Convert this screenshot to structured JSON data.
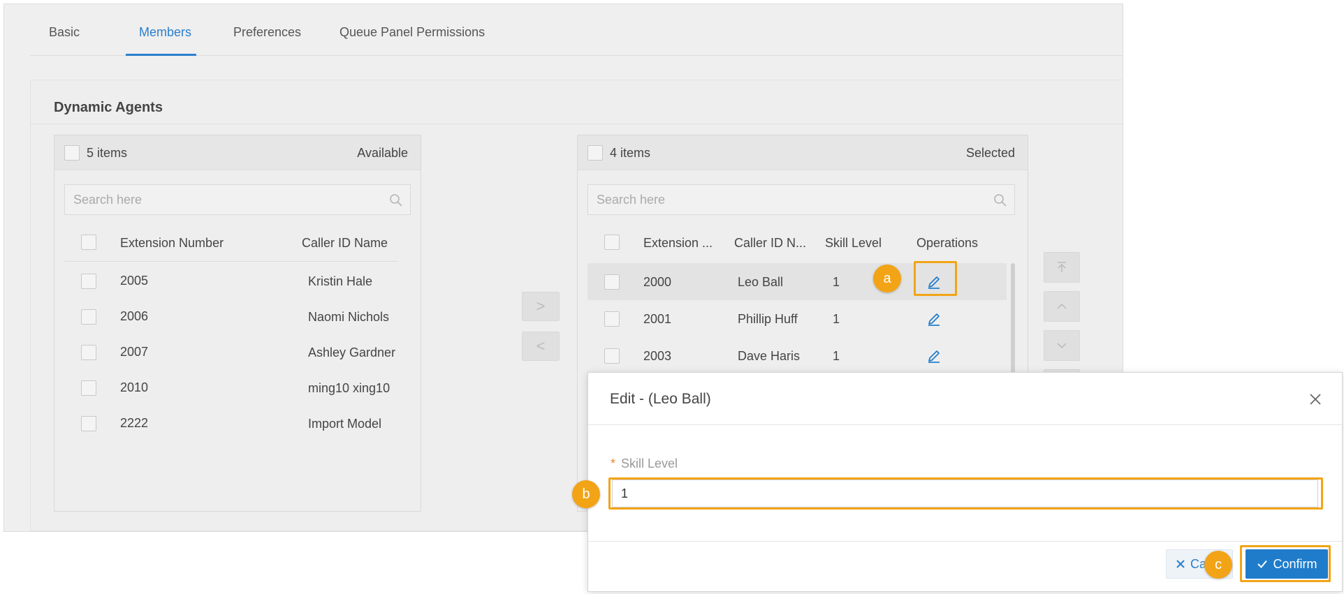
{
  "tabs": [
    {
      "label": "Basic",
      "active": false
    },
    {
      "label": "Members",
      "active": true
    },
    {
      "label": "Preferences",
      "active": false
    },
    {
      "label": "Queue Panel Permissions",
      "active": false
    }
  ],
  "section": {
    "title": "Dynamic Agents"
  },
  "available": {
    "count_label": "5 items",
    "label": "Available",
    "search_placeholder": "Search here",
    "columns": [
      "Extension Number",
      "Caller ID Name"
    ],
    "rows": [
      {
        "ext": "2005",
        "name": "Kristin Hale"
      },
      {
        "ext": "2006",
        "name": "Naomi Nichols"
      },
      {
        "ext": "2007",
        "name": "Ashley Gardner"
      },
      {
        "ext": "2010",
        "name": "ming10 xing10"
      },
      {
        "ext": "2222",
        "name": "Import Model"
      }
    ]
  },
  "selected": {
    "count_label": "4 items",
    "label": "Selected",
    "search_placeholder": "Search here",
    "columns": [
      "Extension ...",
      "Caller ID N...",
      "Skill Level",
      "Operations"
    ],
    "rows": [
      {
        "ext": "2000",
        "name": "Leo Ball",
        "skill": "1"
      },
      {
        "ext": "2001",
        "name": "Phillip Huff",
        "skill": "1"
      },
      {
        "ext": "2003",
        "name": "Dave Haris",
        "skill": "1"
      }
    ]
  },
  "transfer": {
    "right": ">",
    "left": "<"
  },
  "modal": {
    "title": "Edit - (Leo Ball)",
    "field_required": "*",
    "field_label": "Skill Level",
    "field_value": "1",
    "cancel_label": "Ca",
    "confirm_label": "Confirm"
  },
  "markers": {
    "a": "a",
    "b": "b",
    "c": "c"
  },
  "colors": {
    "accent": "#1f7ccb",
    "callout": "#f2a416",
    "tab_active": "#2b7fcc"
  }
}
